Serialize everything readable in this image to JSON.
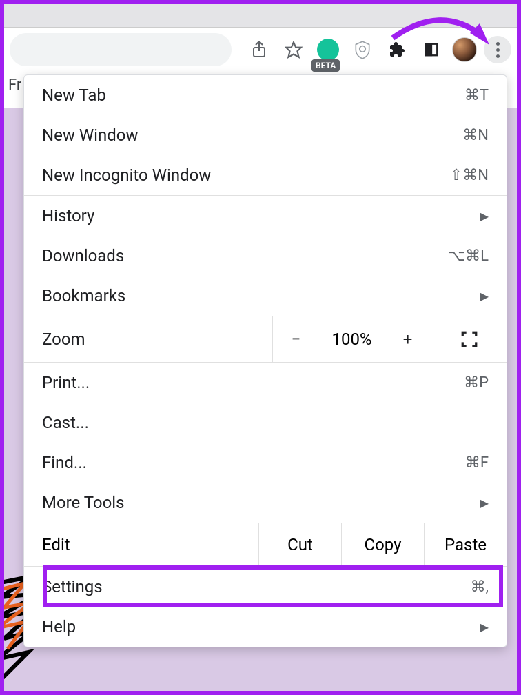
{
  "toolbar": {
    "beta_label": "BETA"
  },
  "bookmarks": {
    "first_visible": "Fr"
  },
  "menu": {
    "new_tab": {
      "label": "New Tab",
      "shortcut": "⌘T"
    },
    "new_window": {
      "label": "New Window",
      "shortcut": "⌘N"
    },
    "incognito": {
      "label": "New Incognito Window",
      "shortcut": "⇧⌘N"
    },
    "history": {
      "label": "History"
    },
    "downloads": {
      "label": "Downloads",
      "shortcut": "⌥⌘L"
    },
    "bookmarks": {
      "label": "Bookmarks"
    },
    "zoom": {
      "label": "Zoom",
      "value": "100%",
      "minus": "−",
      "plus": "+"
    },
    "print": {
      "label": "Print...",
      "shortcut": "⌘P"
    },
    "cast": {
      "label": "Cast..."
    },
    "find": {
      "label": "Find...",
      "shortcut": "⌘F"
    },
    "more_tools": {
      "label": "More Tools"
    },
    "edit": {
      "label": "Edit",
      "cut": "Cut",
      "copy": "Copy",
      "paste": "Paste"
    },
    "settings": {
      "label": "Settings",
      "shortcut": "⌘,"
    },
    "help": {
      "label": "Help"
    }
  }
}
